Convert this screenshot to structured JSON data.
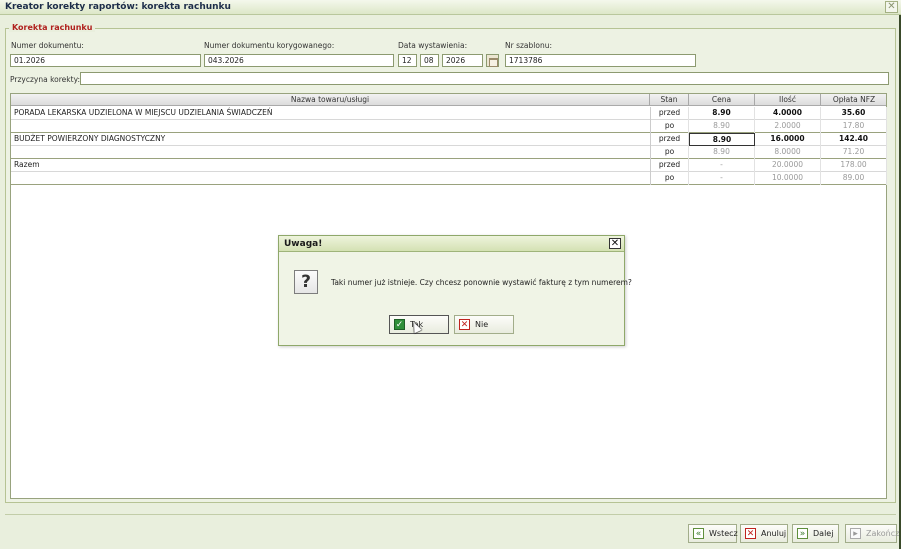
{
  "window": {
    "title": "Kreator korekty raportów: korekta rachunku",
    "close_glyph": "✕"
  },
  "section": {
    "legend": "Korekta rachunku",
    "numer_dokumentu": {
      "label": "Numer dokumentu:",
      "value": "01.2026"
    },
    "numer_korygowanego": {
      "label": "Numer dokumentu korygowanego:",
      "value": "043.2026"
    },
    "data_wystawienia": {
      "label": "Data wystawienia:",
      "day": "12",
      "month": "08",
      "year": "2026"
    },
    "nr_szablonu": {
      "label": "Nr szablonu:",
      "value": "1713786"
    },
    "przyczyna": {
      "label": "Przyczyna korekty:",
      "value": ""
    }
  },
  "table": {
    "columns": [
      "Nazwa towaru/usługi",
      "Stan",
      "Cena",
      "Ilość",
      "Opłata NFZ"
    ],
    "groups": [
      {
        "name": "PORADA LEKARSKA UDZIELONA W MIEJSCU UDZIELANIA ŚWIADCZEŃ",
        "przed": {
          "stan": "przed",
          "cena": "8.90",
          "ilosc": "4.0000",
          "oplata": "35.60"
        },
        "po": {
          "stan": "po",
          "cena": "8.90",
          "ilosc": "2.0000",
          "oplata": "17.80"
        }
      },
      {
        "name": "BUDŻET POWIERZONY DIAGNOSTYCZNY",
        "przed": {
          "stan": "przed",
          "cena": "8.90",
          "ilosc": "16.0000",
          "oplata": "142.40"
        },
        "po": {
          "stan": "po",
          "cena": "8.90",
          "ilosc": "8.0000",
          "oplata": "71.20"
        }
      },
      {
        "name": "Razem",
        "przed": {
          "stan": "przed",
          "cena": "-",
          "ilosc": "20.0000",
          "oplata": "178.00"
        },
        "po": {
          "stan": "po",
          "cena": "-",
          "ilosc": "10.0000",
          "oplata": "89.00"
        }
      }
    ]
  },
  "dialog": {
    "title": "Uwaga!",
    "close_glyph": "✕",
    "icon_glyph": "?",
    "message": "Taki numer już istnieje. Czy chcesz ponownie wystawić fakturę z tym numerem?",
    "yes_label": "Tak",
    "no_label": "Nie"
  },
  "footer": {
    "back_label": "Wstecz",
    "cancel_label": "Anuluj",
    "next_label": "Dalej",
    "finish_label": "Zakończ"
  },
  "icons": {
    "check": "✓",
    "cross": "✕",
    "back": "«",
    "next": "»",
    "finish": "▸"
  }
}
